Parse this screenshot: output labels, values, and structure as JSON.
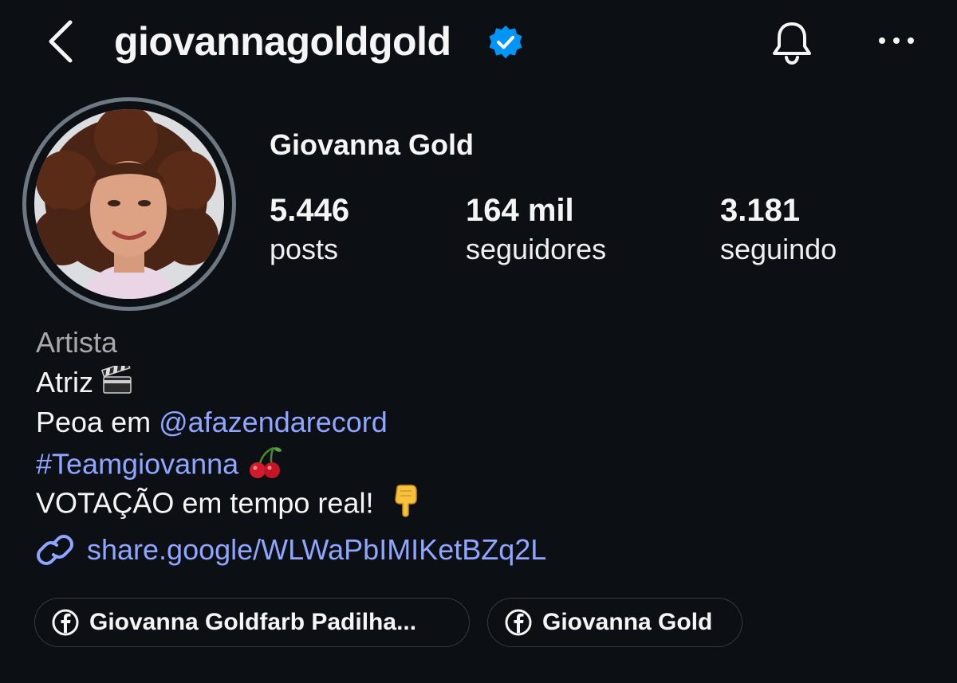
{
  "header": {
    "username": "giovannagoldgold",
    "verified": true,
    "icons": [
      "chevron-left-icon",
      "verified-badge-icon",
      "bell-icon",
      "more-horizontal-icon"
    ]
  },
  "profile": {
    "display_name": "Giovanna Gold",
    "stats": [
      {
        "value": "5.446",
        "label": "posts"
      },
      {
        "value": "164 mil",
        "label": "seguidores"
      },
      {
        "value": "3.181",
        "label": "seguindo"
      }
    ]
  },
  "bio": {
    "category": "Artista",
    "line1": "Atriz",
    "line2_prefix": "Peoa em ",
    "line2_mention": "@afazendarecord",
    "line3_hashtag": "#Teamgiovanna",
    "line4": "VOTAÇÃO em tempo real!",
    "emojis": [
      "clapper-board-icon",
      "cherries-icon",
      "pointing-down-icon"
    ]
  },
  "external_link": "share.google/WLWaPbIMIKetBZq2L",
  "linked_accounts": [
    {
      "platform": "facebook",
      "label": "Giovanna Goldfarb Padilha..."
    },
    {
      "platform": "facebook",
      "label": "Giovanna Gold"
    }
  ],
  "colors": {
    "background": "#0c1014",
    "text": "#f5f5f5",
    "muted": "#a8a8a8",
    "link": "#8ea6ff",
    "verified": "#0095f6",
    "pill_border": "#363b40"
  }
}
